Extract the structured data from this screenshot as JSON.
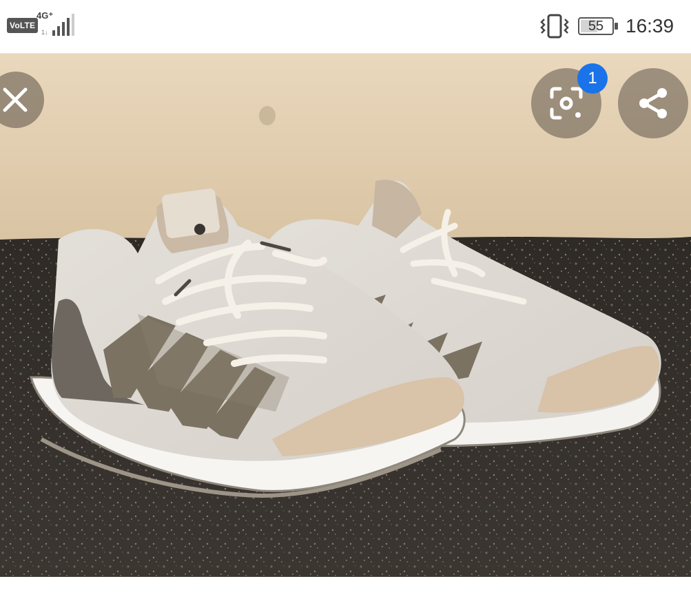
{
  "status_bar": {
    "volte": "VoLTE",
    "network_type": "4G⁺",
    "battery_level": "55",
    "time": "16:39",
    "icons": [
      "signal-icon",
      "vibrate-icon",
      "battery-icon"
    ]
  },
  "viewer": {
    "close_icon": "close-icon",
    "lens_icon": "lens-search-icon",
    "lens_badge_count": "1",
    "share_icon": "share-icon",
    "colors": {
      "badge": "#1a73e8",
      "button_overlay": "#5f554b"
    }
  }
}
